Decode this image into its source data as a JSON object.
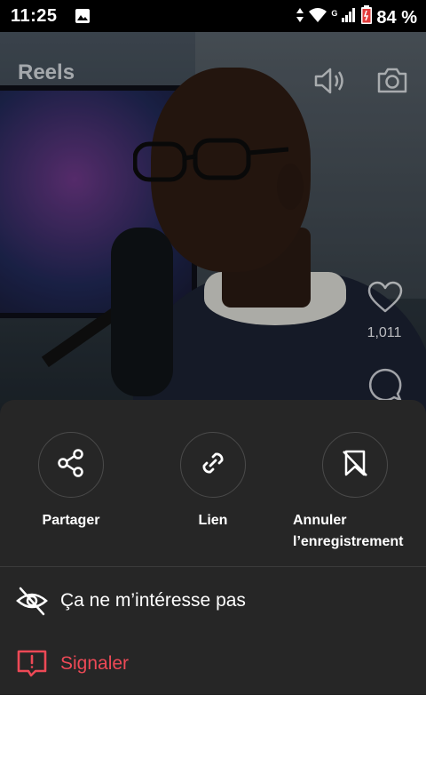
{
  "status_bar": {
    "time": "11:25",
    "network_label": "G",
    "battery": "84 %"
  },
  "reel": {
    "title": "Reels",
    "likes": "1,011"
  },
  "sheet": {
    "actions": [
      {
        "label": "Partager",
        "icon": "share-icon"
      },
      {
        "label": "Lien",
        "icon": "link-icon"
      },
      {
        "label": "Annuler l’enregistrement",
        "icon": "unsave-icon"
      }
    ],
    "options": [
      {
        "label": "Ça ne m’intéresse pas",
        "icon": "eye-off-icon"
      },
      {
        "label": "Signaler",
        "icon": "report-icon",
        "color": "#ed4956"
      }
    ]
  },
  "colors": {
    "sheet_bg": "#262626",
    "danger": "#ed4956"
  }
}
